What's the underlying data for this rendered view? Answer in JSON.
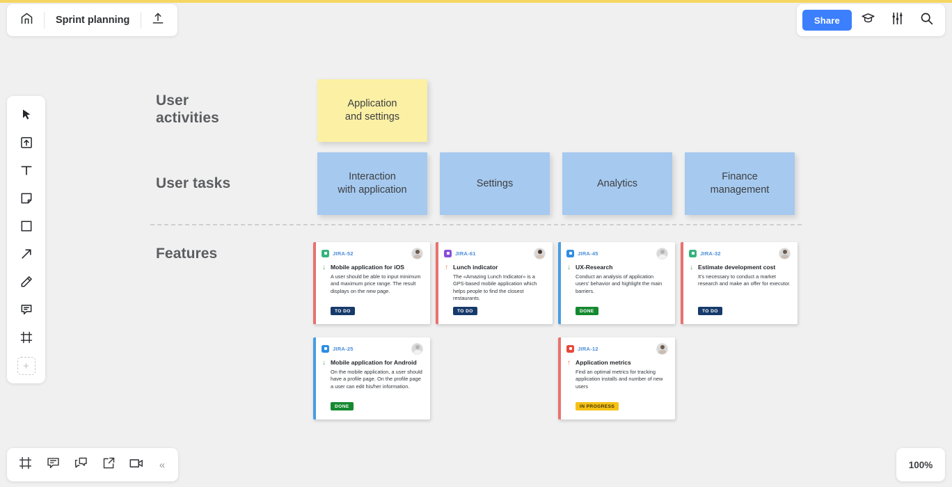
{
  "header": {
    "home_icon": "home-icon",
    "board_title": "Sprint planning",
    "export_icon": "upload-icon",
    "share_label": "Share",
    "learn_icon": "graduation-cap-icon",
    "settings_icon": "sliders-icon",
    "search_icon": "search-icon"
  },
  "toolbar": {
    "tools": [
      {
        "name": "select-tool",
        "icon": "cursor-icon"
      },
      {
        "name": "upload-tool",
        "icon": "upload-box-icon"
      },
      {
        "name": "text-tool",
        "icon": "text-icon"
      },
      {
        "name": "sticky-note-tool",
        "icon": "sticky-note-icon"
      },
      {
        "name": "shape-tool",
        "icon": "square-icon"
      },
      {
        "name": "arrow-tool",
        "icon": "arrow-icon"
      },
      {
        "name": "pen-tool",
        "icon": "pencil-icon"
      },
      {
        "name": "comment-tool",
        "icon": "comment-icon"
      },
      {
        "name": "frame-tool",
        "icon": "frame-icon"
      }
    ],
    "add_label": "+"
  },
  "bottombar": {
    "items": [
      {
        "name": "frames-panel-button",
        "icon": "frame-icon"
      },
      {
        "name": "comments-panel-button",
        "icon": "comment-list-icon"
      },
      {
        "name": "chat-button",
        "icon": "chat-icon"
      },
      {
        "name": "present-button",
        "icon": "external-link-icon"
      },
      {
        "name": "video-call-button",
        "icon": "video-camera-icon"
      }
    ],
    "collapse_label": "«"
  },
  "zoom": {
    "level": "100%"
  },
  "board": {
    "rows": [
      {
        "label": "User\nactivities"
      },
      {
        "label": "User tasks"
      },
      {
        "label": "Features"
      }
    ],
    "row_labels": {
      "activities_line1": "User",
      "activities_line2": "activities",
      "tasks": "User tasks",
      "features": "Features"
    },
    "activities": [
      {
        "text": "Application\nand settings",
        "line1": "Application",
        "line2": "and settings",
        "color": "#fbf0a4"
      }
    ],
    "tasks": [
      {
        "line1": "Interaction",
        "line2": "with application",
        "color": "#a6c9ef"
      },
      {
        "line1": "Settings",
        "line2": "",
        "color": "#a6c9ef"
      },
      {
        "line1": "Analytics",
        "line2": "",
        "color": "#a6c9ef"
      },
      {
        "line1": "Finance",
        "line2": "management",
        "color": "#a6c9ef"
      }
    ],
    "cards": [
      {
        "key": "JIRA-52",
        "type": "story",
        "priority": "low",
        "priority_glyph": "↓",
        "title": "Mobile application for iOS",
        "description": "A user should be able to input minimum and maximum price range. The result displays on the new page.",
        "status": "TO DO",
        "status_color": "#173a6b",
        "bar_color": "#e8726e"
      },
      {
        "key": "JIRA-61",
        "type": "epic",
        "priority": "high",
        "priority_glyph": "↑",
        "title": "Lunch indicator",
        "description": "The «Amazing Lunch Indicator» is a GPS-based mobile application which helps people to find the closest restaurants.",
        "status": "TO DO",
        "status_color": "#173a6b",
        "bar_color": "#e8726e"
      },
      {
        "key": "JIRA-45",
        "type": "task",
        "priority": "low",
        "priority_glyph": "↓",
        "title": "UX-Research",
        "description": "Conduct an analysis of application users' behavior and highlight the main barriers.",
        "status": "DONE",
        "status_color": "#15892f",
        "bar_color": "#4a9de0"
      },
      {
        "key": "JIRA-32",
        "type": "story",
        "priority": "low",
        "priority_glyph": "↓",
        "title": "Estimate development cost",
        "description": "It's necessary to conduct a market research and make an offer for executor.",
        "status": "TO DO",
        "status_color": "#173a6b",
        "bar_color": "#e8726e"
      },
      {
        "key": "JIRA-25",
        "type": "task",
        "priority": "low",
        "priority_glyph": "↓",
        "title": "Mobile application for Android",
        "description": "On the mobile application, a user should have a profile page. On the profile page a user can edit his/her information.",
        "status": "DONE",
        "status_color": "#15892f",
        "bar_color": "#4a9de0"
      },
      {
        "key": "JIRA-12",
        "type": "bug",
        "priority": "high",
        "priority_glyph": "↑",
        "title": "Application metrics",
        "description": "Find an optimal metrics for tracking application installs and number of new users",
        "status": "IN PROGRESS",
        "status_color": "#f5c116",
        "bar_color": "#e8726e"
      }
    ]
  },
  "colors": {
    "accent_top": "#f5d661",
    "share_button": "#3b7ffc",
    "canvas": "#f0f0f0",
    "note_yellow": "#fbf0a4",
    "note_blue": "#a6c9ef"
  }
}
